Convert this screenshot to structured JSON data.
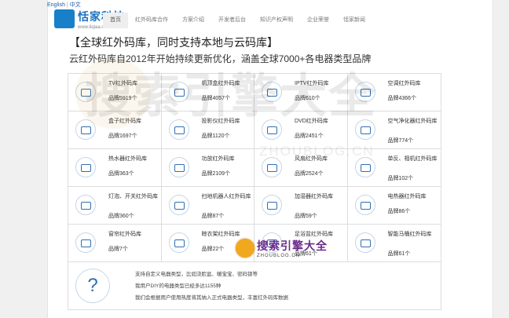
{
  "lang": {
    "en": "English",
    "sep": "|",
    "cn": "中文"
  },
  "brand": {
    "name": "恬家科技",
    "url": "www.tiqiaa.com"
  },
  "nav": [
    {
      "label": "首页",
      "active": true
    },
    {
      "label": "红外码库合作",
      "active": false
    },
    {
      "label": "方案介绍",
      "active": false
    },
    {
      "label": "开发者后台",
      "active": false
    },
    {
      "label": "知识产权声明",
      "active": false
    },
    {
      "label": "企业荣誉",
      "active": false
    },
    {
      "label": "恬家新闻",
      "active": false
    }
  ],
  "heading": {
    "title": "【全球红外码库，同时支持本地与云码库】",
    "subtitle": "云红外码库自2012年开始持续更新优化，涵盖全球7000+各电器类型品牌"
  },
  "devices": [
    {
      "name": "TV红外码库",
      "count": "品牌5919个",
      "icon": "tv-icon"
    },
    {
      "name": "机顶盒红外码库",
      "count": "品牌4057个",
      "icon": "set-top-box-icon"
    },
    {
      "name": "IPTV红外码库",
      "count": "品牌610个",
      "icon": "iptv-icon"
    },
    {
      "name": "空调红外码库",
      "count": "品牌4366个",
      "icon": "air-conditioner-icon"
    },
    {
      "name": "盒子红外码库",
      "count": "品牌1697个",
      "icon": "box-icon"
    },
    {
      "name": "投影仪红外码库",
      "count": "品牌1120个",
      "icon": "projector-icon"
    },
    {
      "name": "DVD红外码库",
      "count": "品牌2451个",
      "icon": "dvd-icon"
    },
    {
      "name": "空气净化器红外码库",
      "count": "品牌774个",
      "icon": "air-purifier-icon"
    },
    {
      "name": "热水器红外码库",
      "count": "品牌363个",
      "icon": "water-heater-icon"
    },
    {
      "name": "功放红外码库",
      "count": "品牌2109个",
      "icon": "amplifier-icon"
    },
    {
      "name": "风扇红外码库",
      "count": "品牌2524个",
      "icon": "fan-icon"
    },
    {
      "name": "单反、相机红外码库",
      "count": "品牌102个",
      "icon": "camera-icon"
    },
    {
      "name": "灯泡、开关红外码库",
      "count": "品牌360个",
      "icon": "light-bulb-icon"
    },
    {
      "name": "扫地机器人红外码库",
      "count": "品牌87个",
      "icon": "robot-vacuum-icon"
    },
    {
      "name": "加湿器红外码库",
      "count": "品牌59个",
      "icon": "humidifier-icon"
    },
    {
      "name": "电热器红外码库",
      "count": "品牌86个",
      "icon": "electric-heater-icon"
    },
    {
      "name": "窗帘红外码库",
      "count": "品牌7个",
      "icon": "curtain-icon"
    },
    {
      "name": "晾衣架红外码库",
      "count": "品牌22个",
      "icon": "clothes-rack-icon"
    },
    {
      "name": "足浴盆红外码库",
      "count": "品牌61个",
      "icon": "foot-bath-icon"
    },
    {
      "name": "智能马桶红外码库",
      "count": "品牌61个",
      "icon": "smart-toilet-icon"
    }
  ],
  "custom": {
    "icon": "?",
    "line1": "支持自定义电器类型，比如浇脸盆、暖宝宝、密码锁等",
    "line2": "我用户DIY的电器类型已经多达1155种",
    "line3": "我们会根据用户使用热度将其纳入正式电器类型，丰富红外码库数据"
  },
  "watermark": {
    "big": "搜索引擎大全",
    "url": "ZHOUBLOG.CN",
    "small_cn": "搜索引擎大全",
    "small_en": "ZHOUBLOG.CN"
  }
}
